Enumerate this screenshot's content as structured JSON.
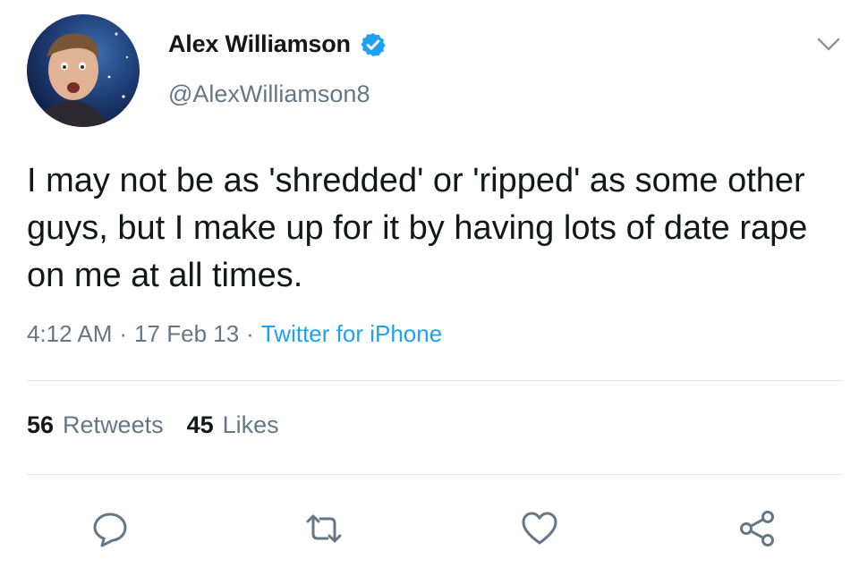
{
  "tweet": {
    "display_name": "Alex Williamson",
    "handle": "@AlexWilliamson8",
    "verified": true,
    "text": "I may not be as 'shredded' or 'ripped' as some other guys, but I make up for it by having lots of date rape on me at all times.",
    "time": "4:12 AM",
    "date": "17 Feb 13",
    "separator": "·",
    "source": "Twitter for iPhone",
    "retweets_count": "56",
    "retweets_label": "Retweets",
    "likes_count": "45",
    "likes_label": "Likes"
  },
  "icons": {
    "verified": "verified-badge-icon",
    "menu": "chevron-down-icon",
    "reply": "reply-icon",
    "retweet": "retweet-icon",
    "like": "heart-icon",
    "share": "share-icon"
  },
  "colors": {
    "text": "#14171a",
    "secondary": "#657786",
    "link": "#1da1f2",
    "divider": "#e1e8ed",
    "action_icon": "#657786"
  }
}
